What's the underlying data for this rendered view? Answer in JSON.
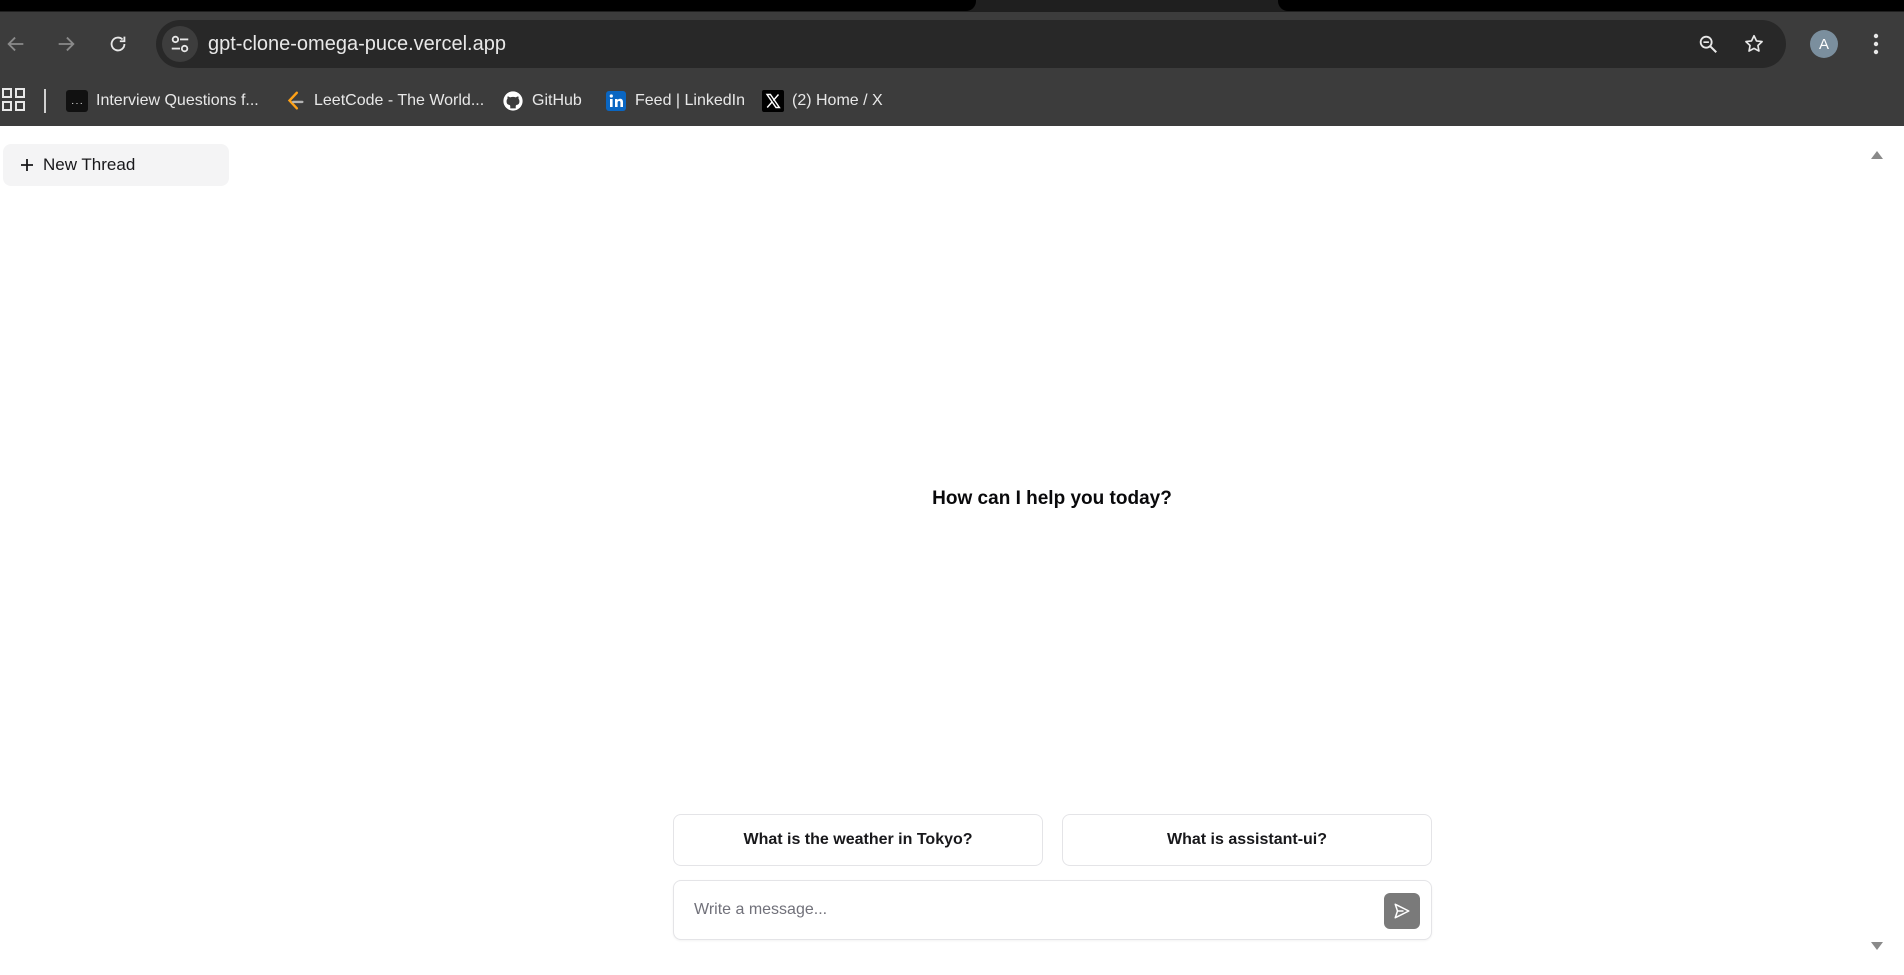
{
  "browser": {
    "url": "gpt-clone-omega-puce.vercel.app",
    "profile_initial": "A",
    "bookmarks": [
      {
        "label": "Interview Questions f...",
        "icon": "interview-favicon"
      },
      {
        "label": "LeetCode - The World...",
        "icon": "leetcode-favicon"
      },
      {
        "label": "GitHub",
        "icon": "github-favicon"
      },
      {
        "label": "Feed | LinkedIn",
        "icon": "linkedin-favicon"
      },
      {
        "label": "(2) Home / X",
        "icon": "x-favicon"
      }
    ],
    "interview_favicon_text": "{ ... }"
  },
  "app": {
    "new_thread_label": "New Thread",
    "welcome_text": "How can I help you today?",
    "suggestions": [
      {
        "label": "What is the weather in Tokyo?"
      },
      {
        "label": "What is assistant-ui?"
      }
    ],
    "composer": {
      "placeholder": "Write a message...",
      "value": ""
    }
  },
  "colors": {
    "chrome_dark": "#3c3c3c",
    "omnibox": "#282828",
    "send_button": "#7a7a7a",
    "new_thread_bg": "#f4f4f5",
    "linkedin_blue": "#0a66c2",
    "leetcode_orange": "#ffa116"
  }
}
